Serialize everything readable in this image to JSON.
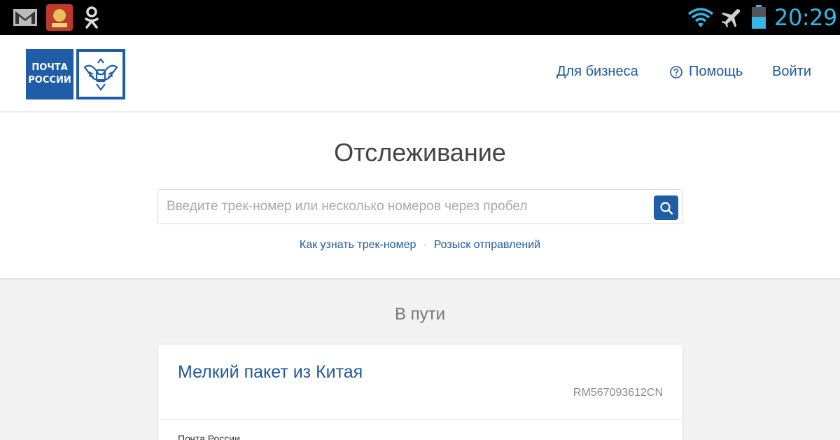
{
  "status_bar": {
    "time": "20:29",
    "colors": {
      "accent": "#33b5e5"
    },
    "icons": [
      "gmail-icon",
      "app-icon",
      "odnoklassniki-icon",
      "wifi-icon",
      "airplane-icon",
      "battery-icon"
    ]
  },
  "header": {
    "logo_text_line1": "ПОЧТА",
    "logo_text_line2": "РОССИИ",
    "nav": {
      "business": "Для бизнеса",
      "help": "Помощь",
      "login": "Войти"
    }
  },
  "tracking": {
    "title": "Отслеживание",
    "search_placeholder": "Введите трек-номер или несколько номеров через пробел",
    "search_value": "",
    "links": {
      "how_to_find": "Как узнать трек-номер",
      "separator": "·",
      "search_parcels": "Розыск отправлений"
    }
  },
  "results": {
    "heading": "В пути",
    "items": [
      {
        "name": "Мелкий пакет из Китая",
        "track_number": "RM567093612CN",
        "carrier": "Почта России"
      }
    ]
  },
  "colors": {
    "brand_blue": "#1f5da7",
    "link_blue": "#1d5a9e",
    "page_bg": "#f2f2f2"
  }
}
